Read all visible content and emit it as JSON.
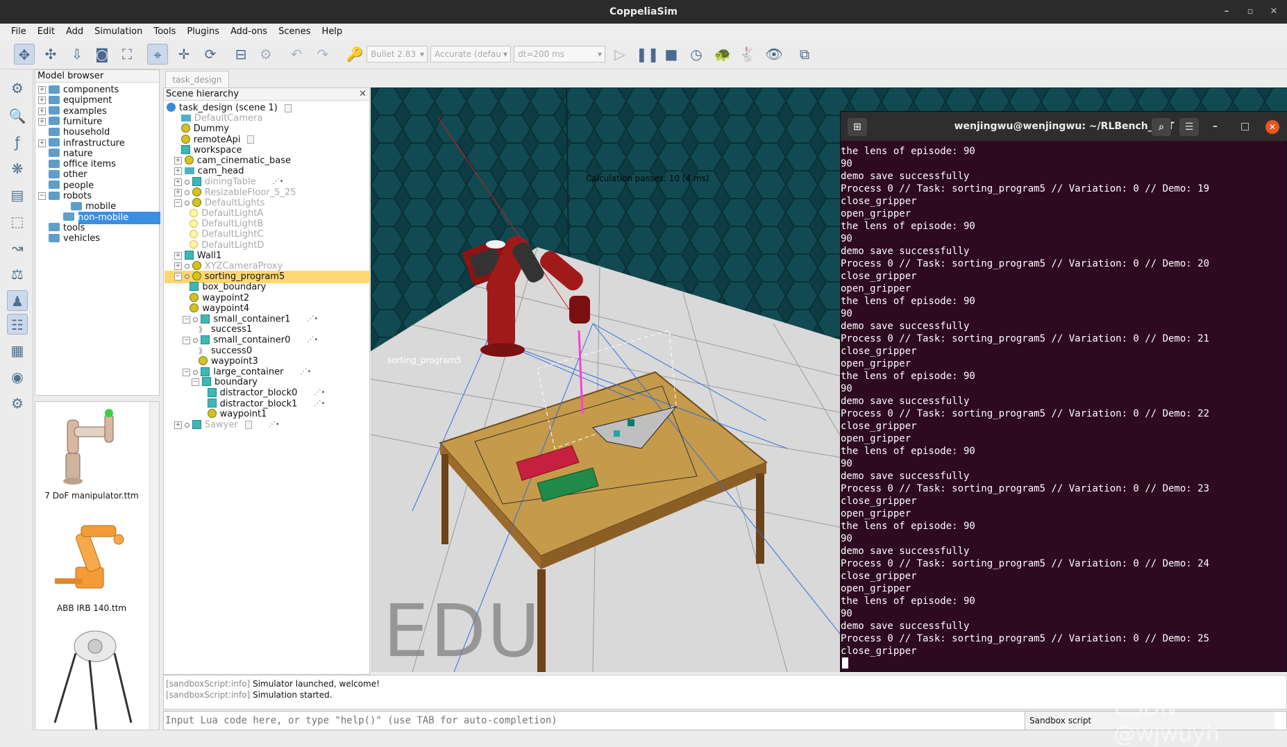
{
  "app": {
    "title": "CoppeliaSim"
  },
  "menu": [
    "File",
    "Edit",
    "Add",
    "Simulation",
    "Tools",
    "Plugins",
    "Add-ons",
    "Scenes",
    "Help"
  ],
  "toolbar": {
    "engine": "Bullet 2.83",
    "accuracy": "Accurate (defau",
    "dt": "dt=200 ms"
  },
  "model_browser": {
    "title": "Model browser",
    "items": [
      {
        "label": "components",
        "expander": "+"
      },
      {
        "label": "equipment",
        "expander": "+"
      },
      {
        "label": "examples",
        "expander": "+"
      },
      {
        "label": "furniture",
        "expander": "+"
      },
      {
        "label": "household",
        "expander": ""
      },
      {
        "label": "infrastructure",
        "expander": "+"
      },
      {
        "label": "nature",
        "expander": ""
      },
      {
        "label": "office items",
        "expander": ""
      },
      {
        "label": "other",
        "expander": ""
      },
      {
        "label": "people",
        "expander": ""
      },
      {
        "label": "robots",
        "expander": "−"
      },
      {
        "label": "mobile",
        "expander": ""
      },
      {
        "label": "non-mobile",
        "expander": ""
      },
      {
        "label": "tools",
        "expander": ""
      },
      {
        "label": "vehicles",
        "expander": ""
      }
    ],
    "thumbnails": [
      "7 DoF manipulator.ttm",
      "ABB IRB 140.ttm"
    ]
  },
  "scene_tab": "task_design",
  "hierarchy": {
    "title": "Scene hierarchy",
    "rows": [
      {
        "label": "task_design (scene 1)"
      },
      {
        "label": "DefaultCamera"
      },
      {
        "label": "Dummy"
      },
      {
        "label": "remoteApi"
      },
      {
        "label": "workspace"
      },
      {
        "label": "cam_cinematic_base"
      },
      {
        "label": "cam_head"
      },
      {
        "label": "diningTable"
      },
      {
        "label": "ResizableFloor_5_25"
      },
      {
        "label": "DefaultLights"
      },
      {
        "label": "DefaultLightA"
      },
      {
        "label": "DefaultLightB"
      },
      {
        "label": "DefaultLightC"
      },
      {
        "label": "DefaultLightD"
      },
      {
        "label": "Wall1"
      },
      {
        "label": "XYZCameraProxy"
      },
      {
        "label": "sorting_program5"
      },
      {
        "label": "box_boundary"
      },
      {
        "label": "waypoint2"
      },
      {
        "label": "waypoint4"
      },
      {
        "label": "small_container1"
      },
      {
        "label": "success1"
      },
      {
        "label": "small_container0"
      },
      {
        "label": "success0"
      },
      {
        "label": "waypoint3"
      },
      {
        "label": "large_container"
      },
      {
        "label": "boundary"
      },
      {
        "label": "distractor_block0"
      },
      {
        "label": "distractor_block1"
      },
      {
        "label": "waypoint1"
      },
      {
        "label": "Sawyer"
      }
    ]
  },
  "viewport": {
    "calc_text": "Calculation passes: 10 (4 ms)",
    "object_label": "sorting_program5",
    "edu_text": "EDU"
  },
  "terminal": {
    "title": "wenjingwu@wenjingwu: ~/RLBench_ACT",
    "lines": [
      "the lens of episode: 90",
      "90",
      "demo save successfully",
      "Process 0 // Task: sorting_program5 // Variation: 0 // Demo: 19",
      "close_gripper",
      "open_gripper",
      "the lens of episode: 90",
      "90",
      "demo save successfully",
      "Process 0 // Task: sorting_program5 // Variation: 0 // Demo: 20",
      "close_gripper",
      "open_gripper",
      "the lens of episode: 90",
      "90",
      "demo save successfully",
      "Process 0 // Task: sorting_program5 // Variation: 0 // Demo: 21",
      "close_gripper",
      "open_gripper",
      "the lens of episode: 90",
      "90",
      "demo save successfully",
      "Process 0 // Task: sorting_program5 // Variation: 0 // Demo: 22",
      "close_gripper",
      "open_gripper",
      "the lens of episode: 90",
      "90",
      "demo save successfully",
      "Process 0 // Task: sorting_program5 // Variation: 0 // Demo: 23",
      "close_gripper",
      "open_gripper",
      "the lens of episode: 90",
      "90",
      "demo save successfully",
      "Process 0 // Task: sorting_program5 // Variation: 0 // Demo: 24",
      "close_gripper",
      "open_gripper",
      "the lens of episode: 90",
      "90",
      "demo save successfully",
      "Process 0 // Task: sorting_program5 // Variation: 0 // Demo: 25",
      "close_gripper"
    ]
  },
  "console": {
    "lines": [
      {
        "tag": "[sandboxScript:info]",
        "text": "Simulator launched, welcome!"
      },
      {
        "tag": "[sandboxScript:info]",
        "text": "Simulation started."
      }
    ]
  },
  "lua": {
    "placeholder": "Input Lua code here, or type \"help()\" (use TAB for auto-completion)",
    "script_selector": "Sandbox script"
  },
  "watermark": "CSDN @wjwuyh"
}
